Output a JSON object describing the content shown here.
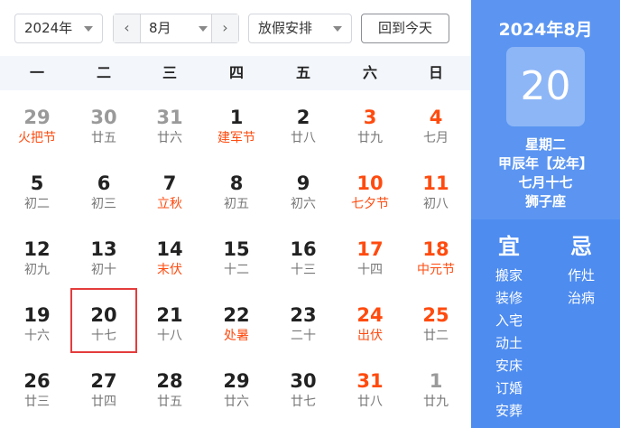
{
  "toolbar": {
    "year": "2024年",
    "month": "8月",
    "holiday": "放假安排",
    "today_button": "回到今天",
    "prev_icon": "‹",
    "next_icon": "›"
  },
  "weekdays": [
    "一",
    "二",
    "三",
    "四",
    "五",
    "六",
    "日"
  ],
  "days": [
    {
      "d": "29",
      "l": "火把节",
      "other": true,
      "fest": true
    },
    {
      "d": "30",
      "l": "廿五",
      "other": true
    },
    {
      "d": "31",
      "l": "廿六",
      "other": true
    },
    {
      "d": "1",
      "l": "建军节",
      "fest": true
    },
    {
      "d": "2",
      "l": "廿八"
    },
    {
      "d": "3",
      "l": "廿九",
      "wkd": true
    },
    {
      "d": "4",
      "l": "七月",
      "wkd": true
    },
    {
      "d": "5",
      "l": "初二"
    },
    {
      "d": "6",
      "l": "初三"
    },
    {
      "d": "7",
      "l": "立秋",
      "fest": true
    },
    {
      "d": "8",
      "l": "初五"
    },
    {
      "d": "9",
      "l": "初六"
    },
    {
      "d": "10",
      "l": "七夕节",
      "wkd": true,
      "fest": true
    },
    {
      "d": "11",
      "l": "初八",
      "wkd": true
    },
    {
      "d": "12",
      "l": "初九"
    },
    {
      "d": "13",
      "l": "初十"
    },
    {
      "d": "14",
      "l": "末伏",
      "fest": true
    },
    {
      "d": "15",
      "l": "十二"
    },
    {
      "d": "16",
      "l": "十三"
    },
    {
      "d": "17",
      "l": "十四",
      "wkd": true
    },
    {
      "d": "18",
      "l": "中元节",
      "wkd": true,
      "fest": true
    },
    {
      "d": "19",
      "l": "十六"
    },
    {
      "d": "20",
      "l": "十七",
      "selected": true
    },
    {
      "d": "21",
      "l": "十八"
    },
    {
      "d": "22",
      "l": "处暑",
      "fest": true
    },
    {
      "d": "23",
      "l": "二十"
    },
    {
      "d": "24",
      "l": "出伏",
      "wkd": true,
      "fest": true
    },
    {
      "d": "25",
      "l": "廿二",
      "wkd": true
    },
    {
      "d": "26",
      "l": "廿三"
    },
    {
      "d": "27",
      "l": "廿四"
    },
    {
      "d": "28",
      "l": "廿五"
    },
    {
      "d": "29",
      "l": "廿六"
    },
    {
      "d": "30",
      "l": "廿七"
    },
    {
      "d": "31",
      "l": "廿八",
      "wkd": true
    },
    {
      "d": "1",
      "l": "廿九",
      "other": true
    }
  ],
  "panel": {
    "title": "2024年8月",
    "day": "20",
    "weekday": "星期二",
    "lunar_year": "甲辰年【龙年】",
    "lunar_date": "七月十七",
    "zodiac": "狮子座",
    "yi_label": "宜",
    "ji_label": "忌",
    "yi": [
      "搬家",
      "装修",
      "入宅",
      "动土",
      "安床",
      "订婚",
      "安葬"
    ],
    "ji": [
      "作灶",
      "治病"
    ]
  },
  "colors": {
    "weekend_red": "#ff4b0f",
    "selected_border": "#e43c3c",
    "panel_blue": "#4e8cf0"
  }
}
